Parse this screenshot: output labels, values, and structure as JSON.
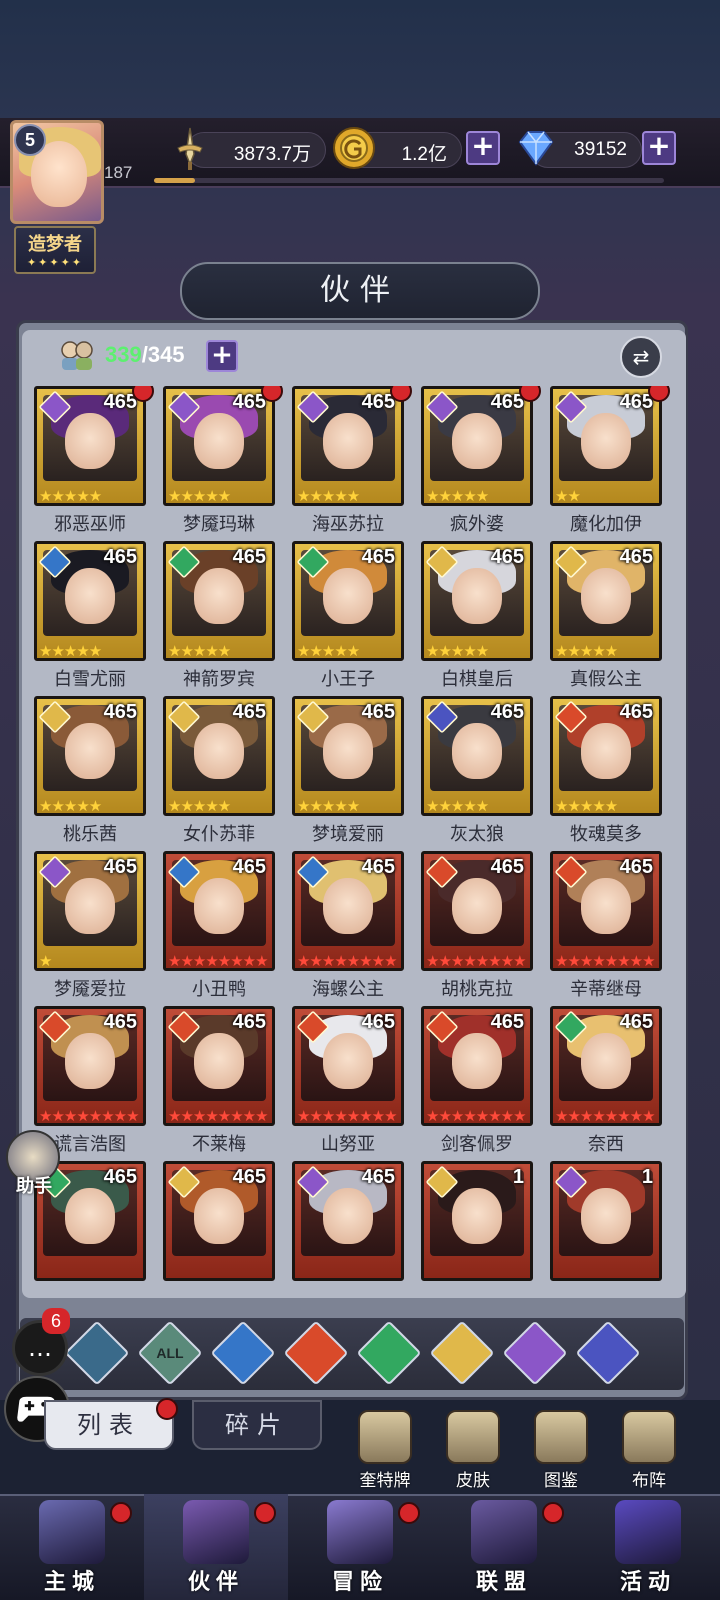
{
  "player": {
    "level": "5",
    "exp_num": "187",
    "exp_progress": 0.08,
    "title": "造梦者",
    "title_stars": "✦✦✦✦✦"
  },
  "resources": {
    "power": "3873.7万",
    "gold": "1.2亿",
    "diamond": "39152",
    "plus": "+"
  },
  "panel": {
    "title": "伙伴",
    "owned": "339",
    "total": "/345",
    "plus": "+",
    "swap_icon": "⇄"
  },
  "heroes": [
    {
      "name": "邪恶巫师",
      "level": "465",
      "element": "dark",
      "frame": "gold",
      "stars": "★★★★★",
      "star_color": "y",
      "dot": true,
      "hair": "#5a2a7a"
    },
    {
      "name": "梦魇玛琳",
      "level": "465",
      "element": "dark",
      "frame": "gold",
      "stars": "★★★★★",
      "star_color": "y",
      "dot": true,
      "hair": "#9a4ab0"
    },
    {
      "name": "海巫苏拉",
      "level": "465",
      "element": "dark",
      "frame": "gold",
      "stars": "★★★★★",
      "star_color": "y",
      "dot": true,
      "hair": "#2a2a36"
    },
    {
      "name": "疯外婆",
      "level": "465",
      "element": "dark",
      "frame": "gold",
      "stars": "★★★★★",
      "star_color": "y",
      "dot": true,
      "hair": "#3a3a44"
    },
    {
      "name": "魔化加伊",
      "level": "465",
      "element": "dark",
      "frame": "gold",
      "stars": "★★",
      "star_color": "y",
      "dot": true,
      "hair": "#c8ccd6"
    },
    {
      "name": "白雪尤丽",
      "level": "465",
      "element": "water",
      "frame": "gold",
      "stars": "★★★★★",
      "star_color": "y",
      "dot": false,
      "hair": "#1a1a22"
    },
    {
      "name": "神箭罗宾",
      "level": "465",
      "element": "wind",
      "frame": "gold",
      "stars": "★★★★★",
      "star_color": "y",
      "dot": false,
      "hair": "#6a4028"
    },
    {
      "name": "小王子",
      "level": "465",
      "element": "wind",
      "frame": "gold",
      "stars": "★★★★★",
      "star_color": "y",
      "dot": false,
      "hair": "#d08a3a"
    },
    {
      "name": "白棋皇后",
      "level": "465",
      "element": "light",
      "frame": "gold",
      "stars": "★★★★★",
      "star_color": "y",
      "dot": false,
      "hair": "#d6d6dc"
    },
    {
      "name": "真假公主",
      "level": "465",
      "element": "light",
      "frame": "gold",
      "stars": "★★★★★",
      "star_color": "y",
      "dot": false,
      "hair": "#e0b468"
    },
    {
      "name": "桃乐茜",
      "level": "465",
      "element": "light",
      "frame": "gold",
      "stars": "★★★★★",
      "star_color": "y",
      "dot": false,
      "hair": "#8a5a38"
    },
    {
      "name": "女仆苏菲",
      "level": "465",
      "element": "light",
      "frame": "gold",
      "stars": "★★★★★",
      "star_color": "y",
      "dot": false,
      "hair": "#7a5a3a"
    },
    {
      "name": "梦境爱丽",
      "level": "465",
      "element": "light",
      "frame": "gold",
      "stars": "★★★★★",
      "star_color": "y",
      "dot": false,
      "hair": "#9a6a48"
    },
    {
      "name": "灰太狼",
      "level": "465",
      "element": "void",
      "frame": "gold",
      "stars": "★★★★★",
      "star_color": "y",
      "dot": false,
      "hair": "#3a3a40"
    },
    {
      "name": "牧魂莫多",
      "level": "465",
      "element": "fire",
      "frame": "gold",
      "stars": "★★★★★",
      "star_color": "y",
      "dot": false,
      "hair": "#b0402a"
    },
    {
      "name": "梦魇爱拉",
      "level": "465",
      "element": "dark",
      "frame": "gold",
      "stars": "★",
      "star_color": "y",
      "dot": false,
      "hair": "#a07040"
    },
    {
      "name": "小丑鸭",
      "level": "465",
      "element": "water",
      "frame": "red",
      "stars": "★★★★★★★★",
      "star_color": "r",
      "dot": false,
      "hair": "#d8a040"
    },
    {
      "name": "海螺公主",
      "level": "465",
      "element": "water",
      "frame": "red",
      "stars": "★★★★★★★★",
      "star_color": "r",
      "dot": false,
      "hair": "#e0c070"
    },
    {
      "name": "胡桃克拉",
      "level": "465",
      "element": "fire",
      "frame": "red",
      "stars": "★★★★★★★★",
      "star_color": "r",
      "dot": false,
      "hair": "#4a2a2a"
    },
    {
      "name": "辛蒂继母",
      "level": "465",
      "element": "fire",
      "frame": "red",
      "stars": "★★★★★★★★",
      "star_color": "r",
      "dot": false,
      "hair": "#b08058"
    },
    {
      "name": "谎言浩图",
      "level": "465",
      "element": "fire",
      "frame": "red",
      "stars": "★★★★★★★★",
      "star_color": "r",
      "dot": false,
      "hair": "#c09050"
    },
    {
      "name": "不莱梅",
      "level": "465",
      "element": "fire",
      "frame": "red",
      "stars": "★★★★★★★★",
      "star_color": "r",
      "dot": false,
      "hair": "#5a3a2a"
    },
    {
      "name": "山努亚",
      "level": "465",
      "element": "fire",
      "frame": "red",
      "stars": "★★★★★★★★",
      "star_color": "r",
      "dot": false,
      "hair": "#e8e8ec"
    },
    {
      "name": "剑客佩罗",
      "level": "465",
      "element": "fire",
      "frame": "red",
      "stars": "★★★★★★★★",
      "star_color": "r",
      "dot": false,
      "hair": "#a0302a"
    },
    {
      "name": "奈西",
      "level": "465",
      "element": "wind",
      "frame": "red",
      "stars": "★★★★★★★★",
      "star_color": "r",
      "dot": false,
      "hair": "#e8c070"
    },
    {
      "name": "",
      "level": "465",
      "element": "wind",
      "frame": "red",
      "stars": "",
      "star_color": "r",
      "dot": false,
      "hair": "#3a5a4a"
    },
    {
      "name": "",
      "level": "465",
      "element": "light",
      "frame": "red",
      "stars": "",
      "star_color": "r",
      "dot": false,
      "hair": "#b05a2a"
    },
    {
      "name": "",
      "level": "465",
      "element": "dark",
      "frame": "red",
      "stars": "",
      "star_color": "r",
      "dot": false,
      "hair": "#b8b8c4"
    },
    {
      "name": "",
      "level": "1",
      "element": "light",
      "frame": "red",
      "stars": "",
      "star_color": "r",
      "dot": false,
      "hair": "#2a1a1a"
    },
    {
      "name": "",
      "level": "1",
      "element": "dark",
      "frame": "red",
      "stars": "",
      "star_color": "r",
      "dot": false,
      "hair": "#a03a2a"
    }
  ],
  "filters": [
    {
      "id": "filter-default",
      "label": "",
      "color": "#3a6a8a"
    },
    {
      "id": "filter-all",
      "label": "ALL",
      "color": "#5a8a7a"
    },
    {
      "id": "filter-water",
      "label": "",
      "color": "#3576c8"
    },
    {
      "id": "filter-fire",
      "label": "",
      "color": "#d94a2a"
    },
    {
      "id": "filter-wind",
      "label": "",
      "color": "#32a860"
    },
    {
      "id": "filter-light",
      "label": "",
      "color": "#e0b84a"
    },
    {
      "id": "filter-dark",
      "label": "",
      "color": "#8b56c8"
    },
    {
      "id": "filter-void",
      "label": "",
      "color": "#4b54c0"
    }
  ],
  "tabs": {
    "list": "列表",
    "fragments": "碎片"
  },
  "sub_buttons": [
    {
      "label": "奎特牌"
    },
    {
      "label": "皮肤"
    },
    {
      "label": "图鉴"
    },
    {
      "label": "布阵"
    }
  ],
  "nav": [
    {
      "label": "主城",
      "active": false,
      "dot": true,
      "color": "#6a6ab0"
    },
    {
      "label": "伙伴",
      "active": true,
      "dot": true,
      "color": "#7a5ab0"
    },
    {
      "label": "冒险",
      "active": false,
      "dot": true,
      "color": "#8a7ad0"
    },
    {
      "label": "联盟",
      "active": false,
      "dot": true,
      "color": "#6a5aa0"
    },
    {
      "label": "活动",
      "active": false,
      "dot": false,
      "color": "#5a4ac0"
    }
  ],
  "assist_label": "助手",
  "chat_badge": "6"
}
